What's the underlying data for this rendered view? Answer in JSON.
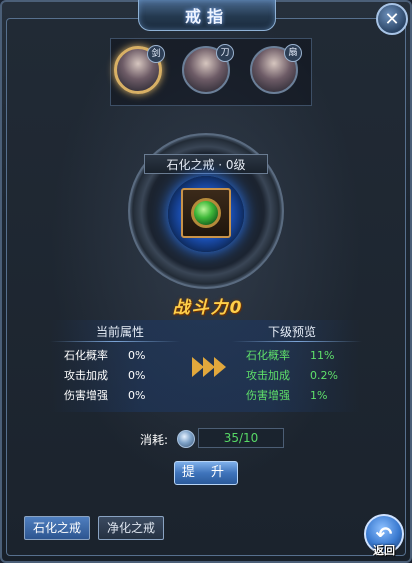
{
  "window": {
    "title": "戒指",
    "close_icon": "close-icon"
  },
  "characters": [
    {
      "badge": "剑",
      "selected": true
    },
    {
      "badge": "刀",
      "selected": false
    },
    {
      "badge": "扇",
      "selected": false
    }
  ],
  "ring": {
    "name_level": "石化之戒 · 0级",
    "item_icon": "ring-item-icon"
  },
  "power": {
    "label": "战斗力0"
  },
  "current": {
    "header": "当前属性",
    "rows": [
      {
        "label": "石化概率",
        "value": "0%"
      },
      {
        "label": "攻击加成",
        "value": "0%"
      },
      {
        "label": "伤害增强",
        "value": "0%"
      }
    ]
  },
  "next": {
    "header": "下级预览",
    "rows": [
      {
        "label": "石化概率",
        "value": "11%"
      },
      {
        "label": "攻击加成",
        "value": "0.2%"
      },
      {
        "label": "伤害增强",
        "value": "1%"
      }
    ]
  },
  "cost": {
    "label": "消耗:",
    "amount": "35/10"
  },
  "upgrade_button": "提 升",
  "tabs": [
    {
      "label": "石化之戒",
      "active": true
    },
    {
      "label": "净化之戒",
      "active": false
    }
  ],
  "back_button": {
    "label": "返回",
    "icon": "back-arrow-icon"
  },
  "colors": {
    "accent_green": "#5fe06a",
    "gold": "#ffcf4a",
    "button_blue": "#3f74bb"
  }
}
